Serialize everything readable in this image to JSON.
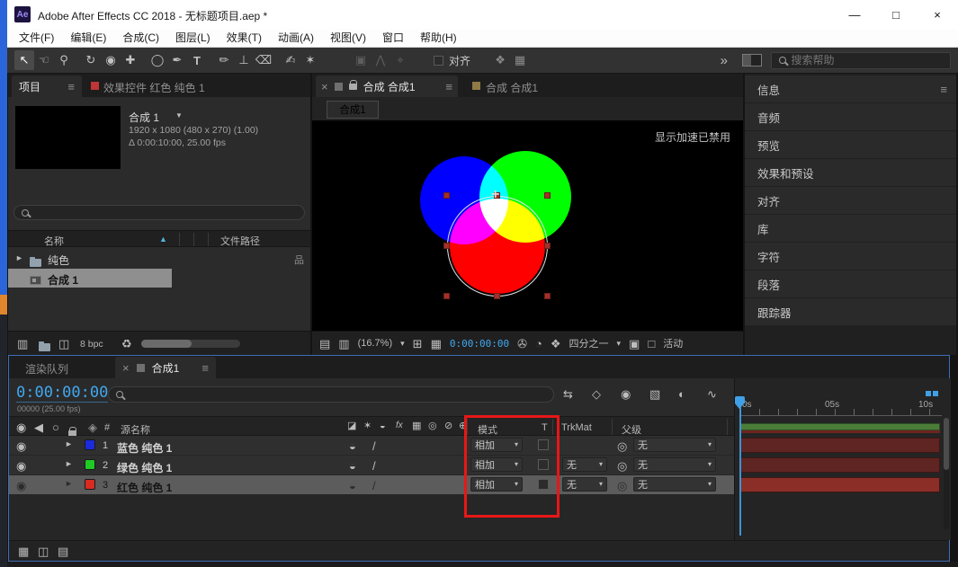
{
  "window": {
    "title": "Adobe After Effects CC 2018 - 无标题项目.aep *",
    "app_badge": "Ae",
    "minimize_glyph": "—",
    "maximize_glyph": "□",
    "close_glyph": "×"
  },
  "menubar": {
    "items": [
      "文件(F)",
      "编辑(E)",
      "合成(C)",
      "图层(L)",
      "效果(T)",
      "动画(A)",
      "视图(V)",
      "窗口",
      "帮助(H)"
    ]
  },
  "toolbar": {
    "tools": [
      {
        "name": "selection",
        "glyph": "↖"
      },
      {
        "name": "hand",
        "glyph": "☜"
      },
      {
        "name": "zoom",
        "glyph": "⚲"
      },
      {
        "name": "rotation",
        "glyph": "↻"
      },
      {
        "name": "unified-camera",
        "glyph": "◉"
      },
      {
        "name": "pan-behind",
        "glyph": "✚"
      },
      {
        "name": "shape",
        "glyph": "◯"
      },
      {
        "name": "pen",
        "glyph": "✒"
      },
      {
        "name": "type",
        "glyph": "T"
      },
      {
        "name": "brush",
        "glyph": "✏"
      },
      {
        "name": "clone-stamp",
        "glyph": "⊥"
      },
      {
        "name": "eraser",
        "glyph": "⌫"
      },
      {
        "name": "roto-brush",
        "glyph": "✍"
      },
      {
        "name": "puppet-pin",
        "glyph": "✶"
      }
    ],
    "axis_mode_glyphs": [
      "▣",
      "⋀",
      "⌖"
    ],
    "snap_label": "对齐",
    "extra_glyphs": [
      "❖",
      "▦"
    ],
    "overflow_glyph": "»",
    "search_placeholder": "搜索帮助"
  },
  "project_panel": {
    "tab_label": "项目",
    "panel_menu_glyph": "≡",
    "effects_tab_label": "效果控件 红色 纯色 1",
    "preview": {
      "title": "合成 1",
      "caret": "▼",
      "dimensions": "1920 x 1080 (480 x 270) (1.00)",
      "duration": "Δ 0:00:10:00, 25.00 fps"
    },
    "columns": {
      "name": "名称",
      "sort_glyph": "▲",
      "path": "文件路径"
    },
    "rows": [
      {
        "disclosure": "►",
        "name": "纯色"
      },
      {
        "name": "合成 1"
      }
    ],
    "usage_glyph": "品",
    "footer_glyphs": [
      "▥",
      "◫"
    ],
    "footer": {
      "depth_label": "8 bpc"
    },
    "delete_glyph": "♻"
  },
  "composition_panel": {
    "close_glyph": "×",
    "tab_label": "合成 合成1",
    "panel_menu_glyph": "≡",
    "secondary_tab_label": "合成 合成1",
    "viewer_tab_label": "合成1",
    "overlay_message": "显示加速已禁用",
    "caret": "▾",
    "footer_glyphs": [
      "▤",
      "▥",
      "⊞",
      "▦",
      "✇",
      "◔",
      "❖",
      "▣",
      "□"
    ],
    "footer": {
      "zoom": "(16.7%)",
      "timecode": "0:00:00:00",
      "resolution": "四分之一",
      "view": "活动"
    }
  },
  "right_sidebar": {
    "panel_menu_glyph": "≡",
    "panels": [
      "信息",
      "音频",
      "预览",
      "效果和预设",
      "对齐",
      "库",
      "字符",
      "段落",
      "跟踪器"
    ]
  },
  "timeline": {
    "render_queue_tab": "渲染队列",
    "close_glyph": "×",
    "active_tab": "合成1",
    "panel_menu_glyph": "≡",
    "timecode": "0:00:00:00",
    "frame_info": "00000 (25.00 fps)",
    "toolbar_glyphs": [
      "⇆",
      "◇",
      "◉",
      "▧",
      "◐",
      "∿"
    ],
    "av_glyphs": [
      "◉",
      "◀",
      "○"
    ],
    "label_column_glyph": "◈",
    "hash_label": "#",
    "source_name_label": "源名称",
    "switch_glyphs": [
      "◪",
      "✶",
      "◒",
      "fx",
      "▦",
      "◎",
      "⊘",
      "⊕"
    ],
    "mode_label": "模式",
    "preserve_label": "T",
    "trkmat_label": "TrkMat",
    "parent_label": "父级",
    "caret": "▾",
    "pickwhip_glyph": "◎",
    "disclosure": "►",
    "eye_glyph": "◉",
    "quality_glyph": "◒",
    "slash_glyph": "/",
    "layers": [
      {
        "num": "1",
        "name": "蓝色 纯色 1",
        "mode": "相加",
        "parent": "无"
      },
      {
        "num": "2",
        "name": "绿色 纯色 1",
        "mode": "相加",
        "trkmat": "无",
        "parent": "无"
      },
      {
        "num": "3",
        "name": "红色 纯色 1",
        "mode": "相加",
        "trkmat": "无",
        "parent": "无"
      }
    ],
    "ruler_labels": [
      "0s",
      "05s",
      "10s"
    ]
  },
  "colors": {
    "accent_blue": "#3fa0e8",
    "timecode_cyan": "#41a8f0",
    "annotation_red": "#e81717",
    "layer_blue": "#1b2bdc",
    "layer_green": "#1fca24",
    "layer_red": "#d92b21",
    "venn_blue": "#0000ff",
    "venn_green": "#00ff00",
    "venn_red": "#ff0000",
    "workarea_green": "#4c7c39"
  }
}
